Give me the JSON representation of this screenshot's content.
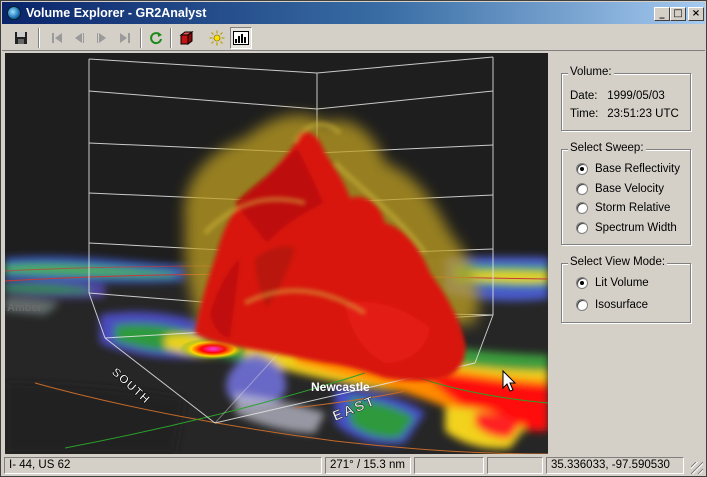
{
  "window": {
    "title": "Volume Explorer - GR2Analyst",
    "controls": [
      "_",
      "□",
      "×"
    ]
  },
  "toolbar": {
    "buttons": [
      {
        "name": "save",
        "icon": "save-icon"
      },
      {
        "name": "first-frame",
        "icon": "skip-first-icon",
        "enabled": false
      },
      {
        "name": "prev-frame",
        "icon": "step-back-icon",
        "enabled": false
      },
      {
        "name": "next-frame",
        "icon": "step-forward-icon",
        "enabled": false
      },
      {
        "name": "last-frame",
        "icon": "skip-last-icon",
        "enabled": false
      },
      {
        "name": "refresh",
        "icon": "refresh-icon"
      },
      {
        "name": "cube-view",
        "icon": "cube-icon"
      },
      {
        "name": "lighting",
        "icon": "light-icon"
      },
      {
        "name": "colortable",
        "icon": "colortable-icon",
        "pressed": true
      }
    ]
  },
  "viewport": {
    "labels": {
      "town1": "Newcastle",
      "town2": "Amber",
      "axis_south": "SOUTH",
      "axis_east": "EAST"
    }
  },
  "volume": {
    "title": "Volume:",
    "date_label": "Date:",
    "date_value": "1999/05/03",
    "time_label": "Time:",
    "time_value": "23:51:23 UTC"
  },
  "sweep": {
    "title": "Select Sweep:",
    "options": [
      {
        "label": "Base Reflectivity",
        "selected": true
      },
      {
        "label": "Base Velocity",
        "selected": false
      },
      {
        "label": "Storm Relative",
        "selected": false
      },
      {
        "label": "Spectrum Width",
        "selected": false
      }
    ]
  },
  "view_mode": {
    "title": "Select View Mode:",
    "options": [
      {
        "label": "Lit Volume",
        "selected": true
      },
      {
        "label": "Isosurface",
        "selected": false
      }
    ]
  },
  "status": {
    "road": "I- 44, US 62",
    "bearing": "271° / 15.3 nm",
    "cell3": "",
    "cell4": "",
    "coords": "35.336033, -97.590530"
  }
}
